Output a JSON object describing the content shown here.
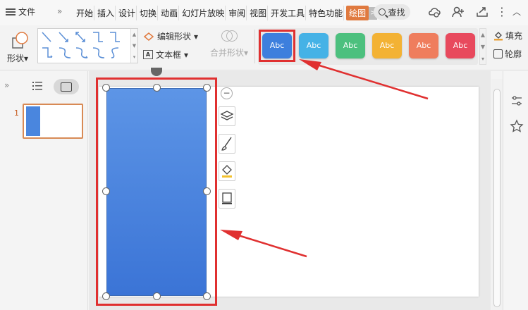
{
  "menubar": {
    "file_label": "文件",
    "more_label": "»",
    "tabs": [
      "开始",
      "插入",
      "设计",
      "切换",
      "动画",
      "幻灯片放映",
      "审阅",
      "视图",
      "开发工具",
      "特色功能",
      "绘图"
    ],
    "active_tab_index": 10,
    "tab_scroll_label": ">",
    "search_label": "查找"
  },
  "ribbon": {
    "shape_label": "形状",
    "edit_shape_label": "编辑形状",
    "textbox_label": "文本框",
    "merge_shape_label": "合并形状",
    "style_buttons": [
      {
        "label": "Abc",
        "color": "#3d7fdd",
        "selected": true
      },
      {
        "label": "Abc",
        "color": "#45b2e6",
        "selected": false
      },
      {
        "label": "Abc",
        "color": "#4cc07e",
        "selected": false
      },
      {
        "label": "Abc",
        "color": "#f3b234",
        "selected": false
      },
      {
        "label": "Abc",
        "color": "#ef7d5d",
        "selected": false
      },
      {
        "label": "Abc",
        "color": "#e8495d",
        "selected": false
      }
    ],
    "fill_label": "填充",
    "outline_label": "轮廓"
  },
  "panel": {
    "slide_number": "1"
  },
  "colors": {
    "accent": "#e07a3f",
    "highlight": "#e03030",
    "shape_fill": "#4a86de"
  }
}
